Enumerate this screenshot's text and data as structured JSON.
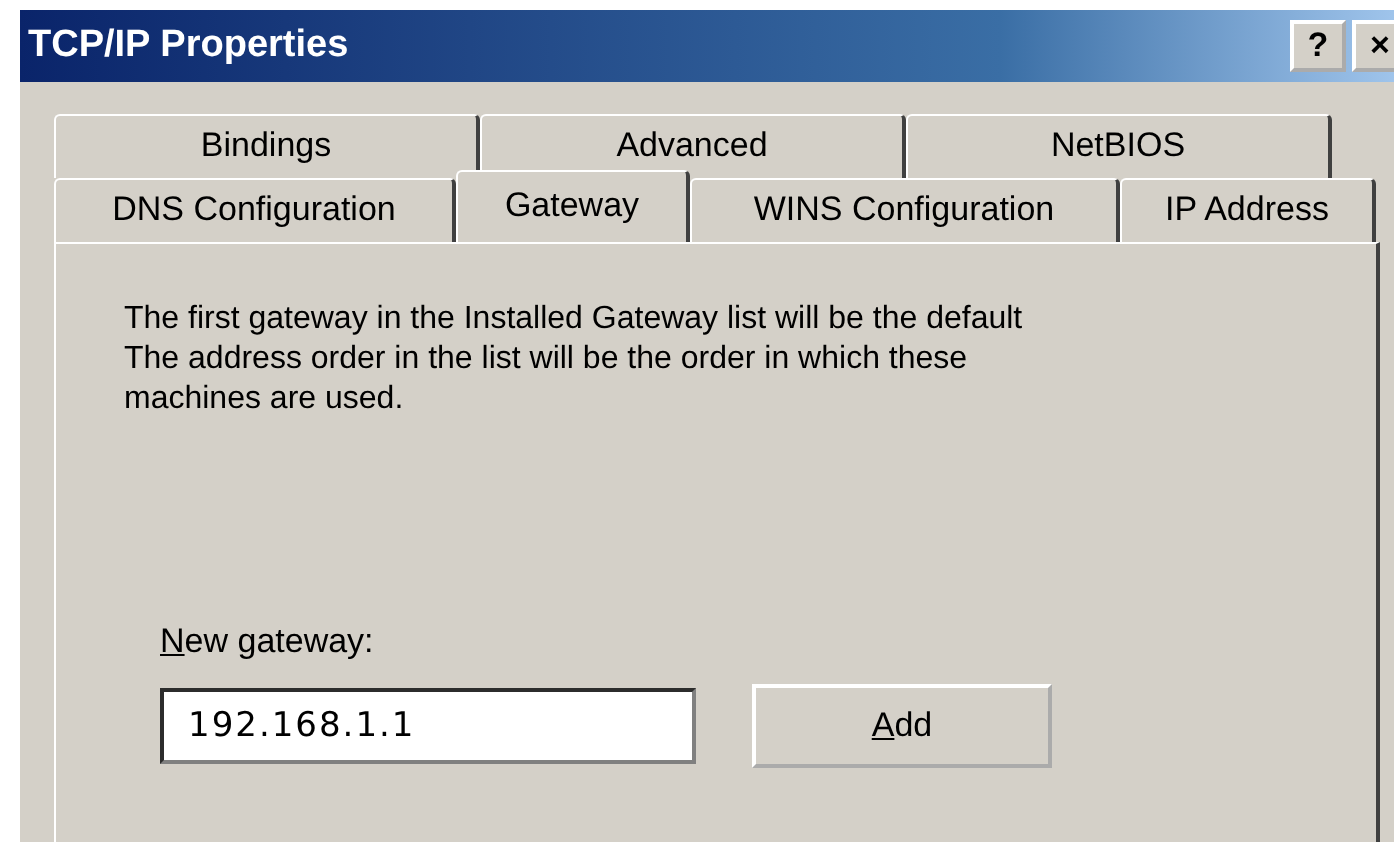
{
  "window": {
    "title": "TCP/IP Properties",
    "title_buttons": [
      "?",
      "×"
    ]
  },
  "tab_rows": [
    [
      {
        "label": "Bindings",
        "selected": false
      },
      {
        "label": "Advanced",
        "selected": false
      },
      {
        "label": "NetBIOS",
        "selected": false
      }
    ],
    [
      {
        "label": "DNS Configuration",
        "selected": false
      },
      {
        "label": "Gateway",
        "selected": true
      },
      {
        "label": "WINS Configuration",
        "selected": false
      },
      {
        "label": "IP Address",
        "selected": false
      }
    ]
  ],
  "description_lines": [
    "The first gateway in the Installed Gateway list will be the default",
    "The address order in the list will be the order in which these",
    "machines are used."
  ],
  "new_gateway": {
    "label_parts": [
      {
        "text": "N",
        "underlined": true
      },
      {
        "text": "ew gateway:",
        "underlined": false
      }
    ],
    "value": "192.168.1.1"
  },
  "add_button": {
    "label_parts": [
      {
        "text": "A",
        "underlined": true
      },
      {
        "text": "dd",
        "underlined": false
      }
    ]
  }
}
